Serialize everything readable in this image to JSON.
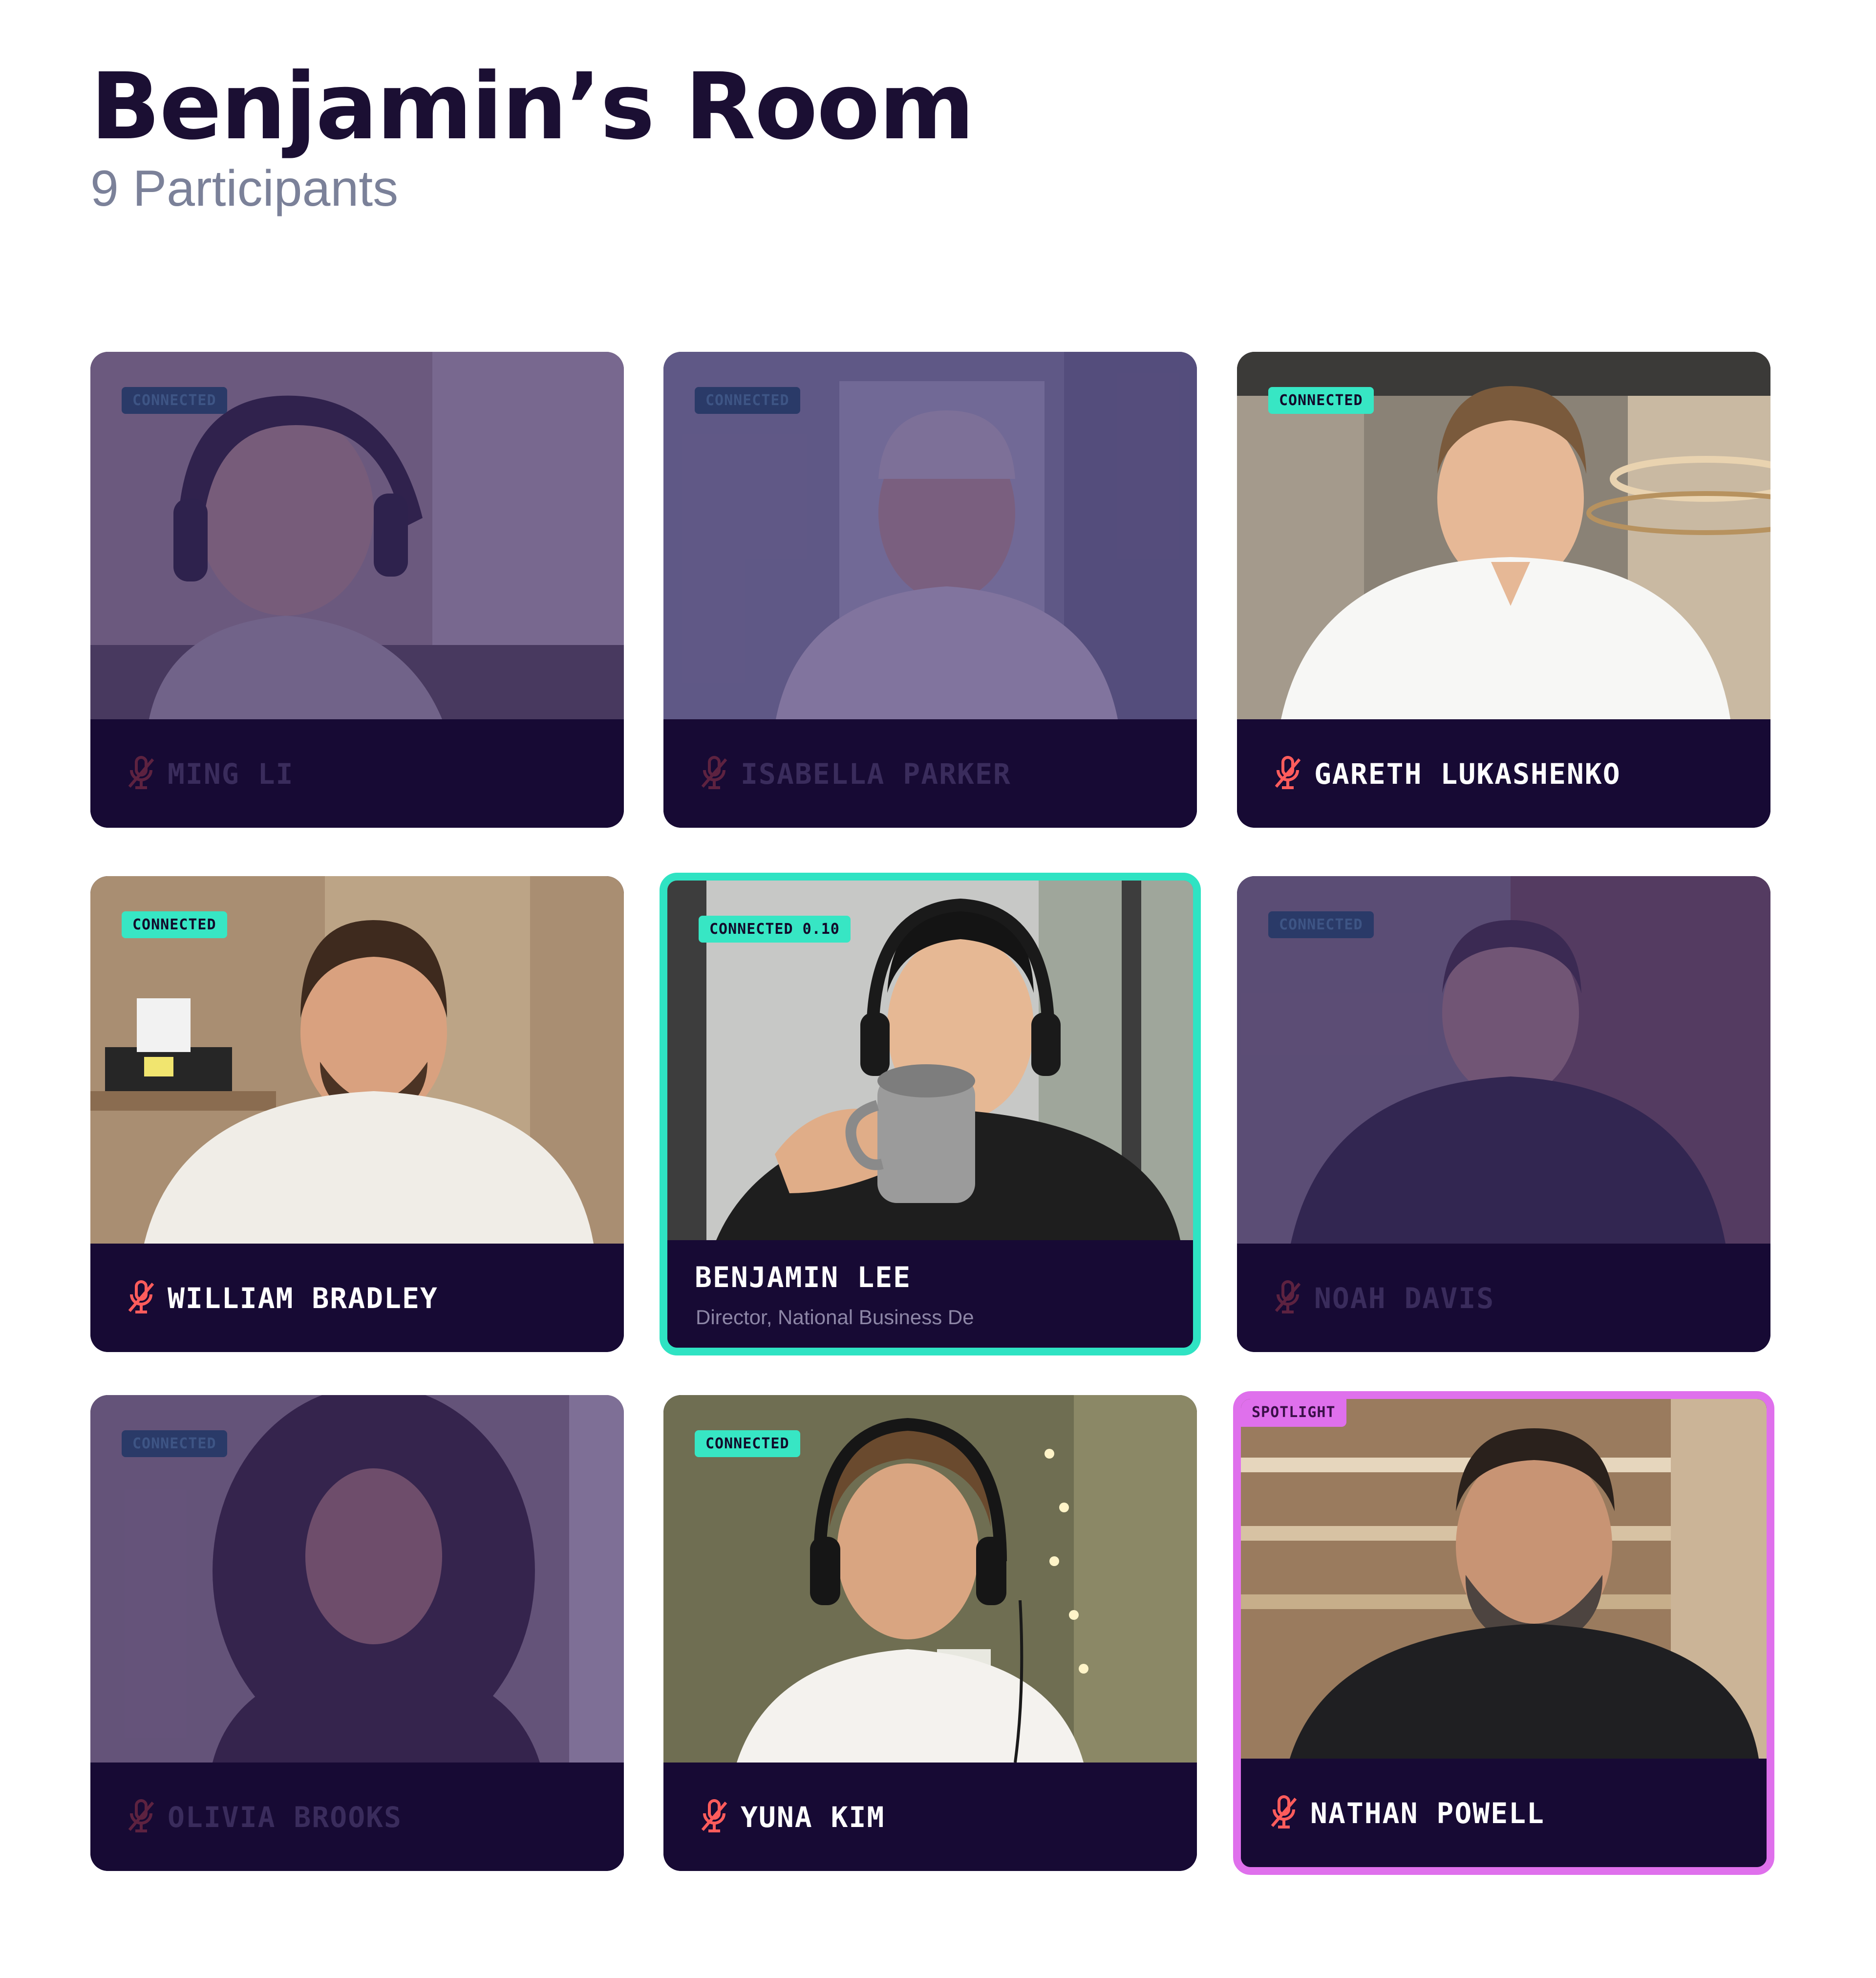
{
  "room": {
    "title": "Benjamin’s Room",
    "participant_count": "9 Participants"
  },
  "colors": {
    "tile_background": "#170a34",
    "connected_badge": "#37e6c4",
    "active_border": "#2fe3c3",
    "spotlight": "#df70ec",
    "muted_mic": "#ff5c5c"
  },
  "participants": [
    {
      "name": "MING LI",
      "badge": "CONNECTED",
      "muted": true,
      "dimmed": true
    },
    {
      "name": "ISABELLA PARKER",
      "badge": "CONNECTED",
      "muted": true,
      "dimmed": true
    },
    {
      "name": "GARETH LUKASHENKO",
      "badge": "CONNECTED",
      "muted": true,
      "dimmed": false
    },
    {
      "name": "WILLIAM BRADLEY",
      "badge": "CONNECTED",
      "muted": true,
      "dimmed": false
    },
    {
      "name": "BENJAMIN LEE",
      "badge": "CONNECTED 0.10",
      "subtitle": "Director, National Business De",
      "muted": false,
      "dimmed": false,
      "active": true
    },
    {
      "name": "NOAH DAVIS",
      "badge": "CONNECTED",
      "muted": true,
      "dimmed": true
    },
    {
      "name": "OLIVIA BROOKS",
      "badge": "CONNECTED",
      "muted": true,
      "dimmed": true
    },
    {
      "name": "YUNA KIM",
      "badge": "CONNECTED",
      "muted": true,
      "dimmed": false
    },
    {
      "name": "NATHAN POWELL",
      "badge": "SPOTLIGHT",
      "muted": true,
      "dimmed": false,
      "spotlight": true
    }
  ]
}
